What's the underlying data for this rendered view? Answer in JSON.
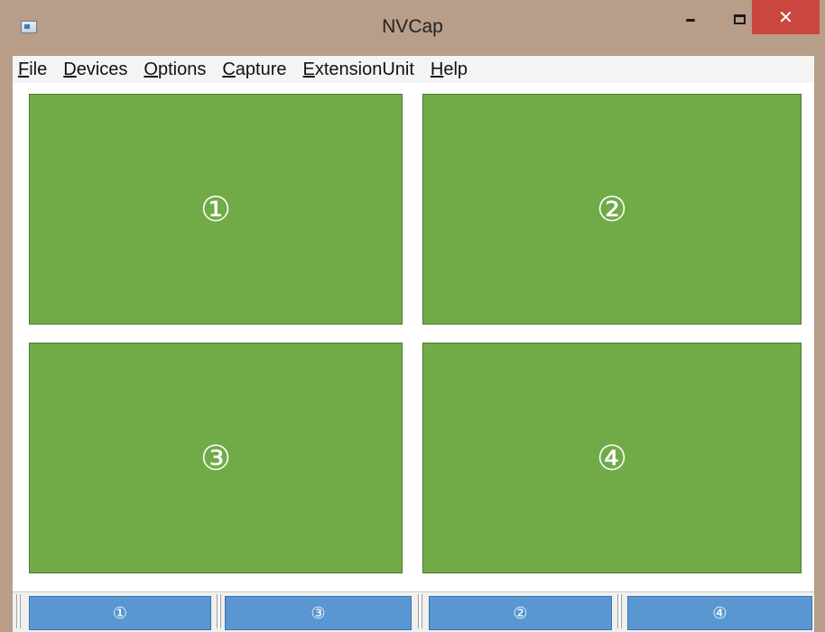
{
  "window": {
    "title": "NVCap",
    "controls": {
      "minimize": "–",
      "close": "✕"
    }
  },
  "menu": {
    "items": [
      {
        "accel": "F",
        "rest": "ile"
      },
      {
        "accel": "D",
        "rest": "evices"
      },
      {
        "accel": "O",
        "rest": "ptions"
      },
      {
        "accel": "C",
        "rest": "apture"
      },
      {
        "accel": "E",
        "rest": "xtensionUnit"
      },
      {
        "accel": "H",
        "rest": "elp"
      }
    ]
  },
  "panes": [
    {
      "label": "①"
    },
    {
      "label": "②"
    },
    {
      "label": "③"
    },
    {
      "label": "④"
    }
  ],
  "tabs": [
    {
      "label": "①"
    },
    {
      "label": "③"
    },
    {
      "label": "②"
    },
    {
      "label": "④"
    }
  ],
  "colors": {
    "titlebar": "#b89d88",
    "close_button": "#c9473f",
    "pane_fill": "#71ab48",
    "tab_fill": "#5a97d2"
  },
  "icons": {
    "app": "window-app-icon",
    "minimize": "minimize-icon",
    "maximize": "maximize-icon",
    "close": "close-icon"
  }
}
